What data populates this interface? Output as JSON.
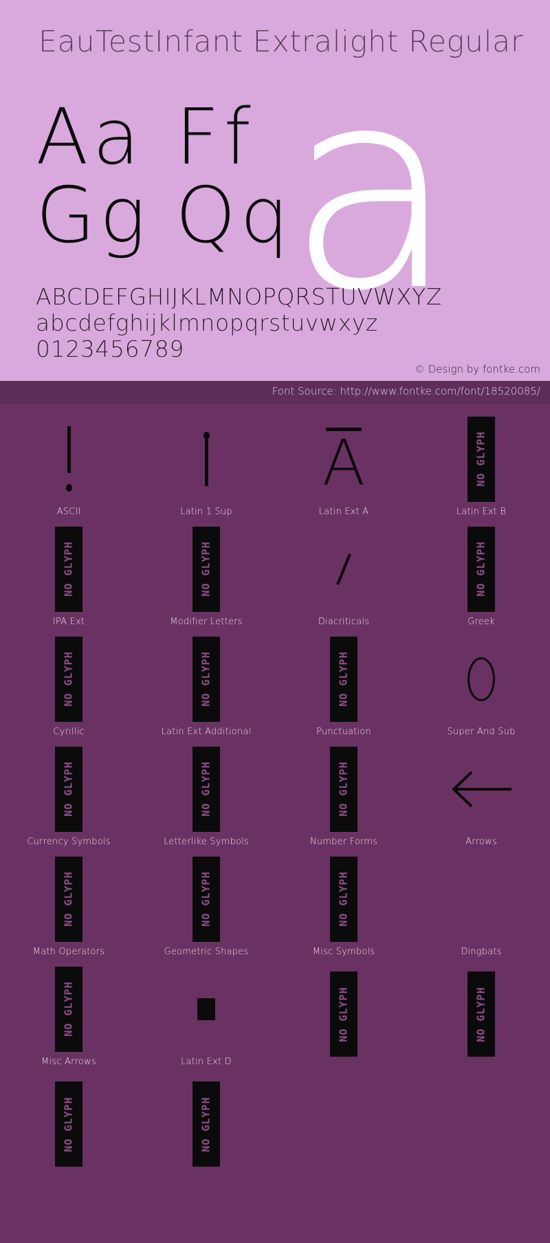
{
  "specimen": {
    "title": "EauTestInfant Extralight Regular",
    "sample_pairs": [
      "Aa",
      "Ff",
      "Gg",
      "Qq"
    ],
    "giant_letter": "a",
    "alphabet_upper": "ABCDEFGHIJKLMNOPQRSTUVWXYZ",
    "alphabet_lower": "abcdefghijklmnopqrstuvwxyz",
    "digits": "0123456789",
    "copyright": "© Design by fontke.com",
    "colors": {
      "specimen_bg": "#d9a9dd",
      "panel_bg": "#6a3262",
      "source_bar_bg": "#5e2d58",
      "glyph_ink": "#0b0b0b",
      "giant_letter": "#ffffff",
      "label_text": "#e7d6e7"
    }
  },
  "source": {
    "text": "Font Source: http://www.fontke.com/font/18520085/"
  },
  "blocks": {
    "no_glyph_text": "NO GLYPH",
    "rows": [
      [
        {
          "label": "ASCII",
          "glyph": "!",
          "kind": "exclam"
        },
        {
          "label": "Latin 1 Sup",
          "glyph": "¡",
          "kind": "invexclam"
        },
        {
          "label": "Latin Ext A",
          "glyph": "Ā",
          "kind": "macron-a"
        },
        {
          "label": "Latin Ext B",
          "glyph": "",
          "kind": "noglyph"
        }
      ],
      [
        {
          "label": "IPA Ext",
          "glyph": "",
          "kind": "noglyph"
        },
        {
          "label": "Modifier Letters",
          "glyph": "",
          "kind": "noglyph"
        },
        {
          "label": "Diacriticals",
          "glyph": "̀",
          "kind": "slash"
        },
        {
          "label": "Greek",
          "glyph": "",
          "kind": "noglyph"
        }
      ],
      [
        {
          "label": "Cyrillic",
          "glyph": "",
          "kind": "noglyph"
        },
        {
          "label": "Latin Ext Additional",
          "glyph": "",
          "kind": "noglyph"
        },
        {
          "label": "Punctuation",
          "glyph": "",
          "kind": "noglyph"
        },
        {
          "label": "Super And Sub",
          "glyph": "⁰",
          "kind": "ellipse"
        }
      ],
      [
        {
          "label": "Currency Symbols",
          "glyph": "",
          "kind": "noglyph"
        },
        {
          "label": "Letterlike Symbols",
          "glyph": "",
          "kind": "noglyph"
        },
        {
          "label": "Number Forms",
          "glyph": "",
          "kind": "noglyph"
        },
        {
          "label": "Arrows",
          "glyph": "←",
          "kind": "arrow"
        }
      ],
      [
        {
          "label": "Math Operators",
          "glyph": "",
          "kind": "noglyph"
        },
        {
          "label": "Geometric Shapes",
          "glyph": "",
          "kind": "noglyph"
        },
        {
          "label": "Misc Symbols",
          "glyph": "",
          "kind": "noglyph"
        },
        {
          "label": "Dingbats",
          "glyph": "",
          "kind": "blank"
        }
      ],
      [
        {
          "label": "Misc Arrows",
          "glyph": "",
          "kind": "noglyph"
        },
        {
          "label": "Latin Ext D",
          "glyph": "■",
          "kind": "square"
        },
        {
          "label": "",
          "glyph": "",
          "kind": "noglyph"
        },
        {
          "label": "",
          "glyph": "",
          "kind": "noglyph"
        }
      ],
      [
        {
          "label": "",
          "glyph": "",
          "kind": "noglyph"
        },
        {
          "label": "",
          "glyph": "",
          "kind": "noglyph"
        },
        {
          "label": "",
          "glyph": "",
          "kind": "blank"
        },
        {
          "label": "",
          "glyph": "",
          "kind": "blank"
        }
      ]
    ]
  }
}
